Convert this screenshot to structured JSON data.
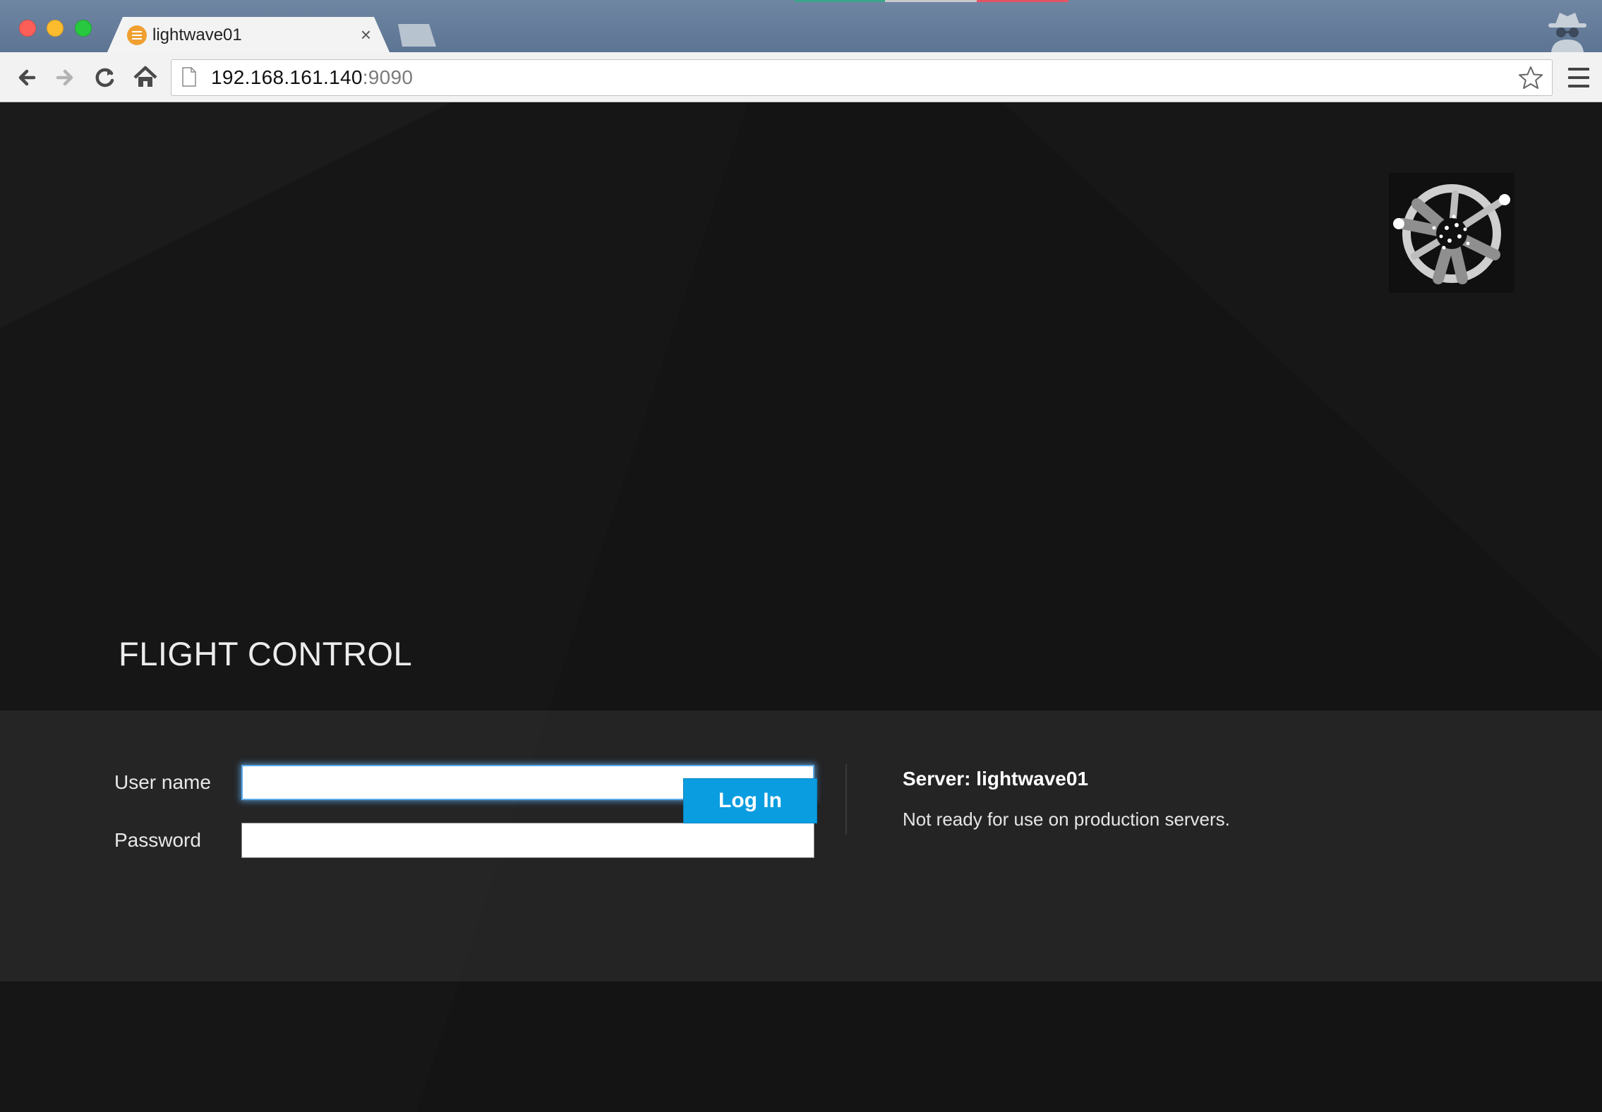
{
  "browser": {
    "tab_title": "lightwave01",
    "tab_close": "×",
    "url_host": "192.168.161.140",
    "url_port": ":9090",
    "icons": {
      "back": "back-arrow-icon",
      "forward": "forward-arrow-icon",
      "reload": "reload-icon",
      "home": "home-icon",
      "page": "page-icon",
      "bookmark": "star-icon",
      "menu": "hamburger-menu-icon",
      "incognito": "incognito-icon",
      "favicon": "favicon-icon"
    }
  },
  "page": {
    "brand": "FLIGHT CONTROL",
    "form": {
      "username_label": "User name",
      "username_value": "",
      "password_label": "Password",
      "password_value": "",
      "login_label": "Log In"
    },
    "server": {
      "title": "Server: lightwave01",
      "message": "Not ready for use on production servers."
    },
    "colors": {
      "login_button": "#0a9de0",
      "focus_ring": "#5aa8e6",
      "background": "#141415",
      "band": "#282829"
    }
  }
}
